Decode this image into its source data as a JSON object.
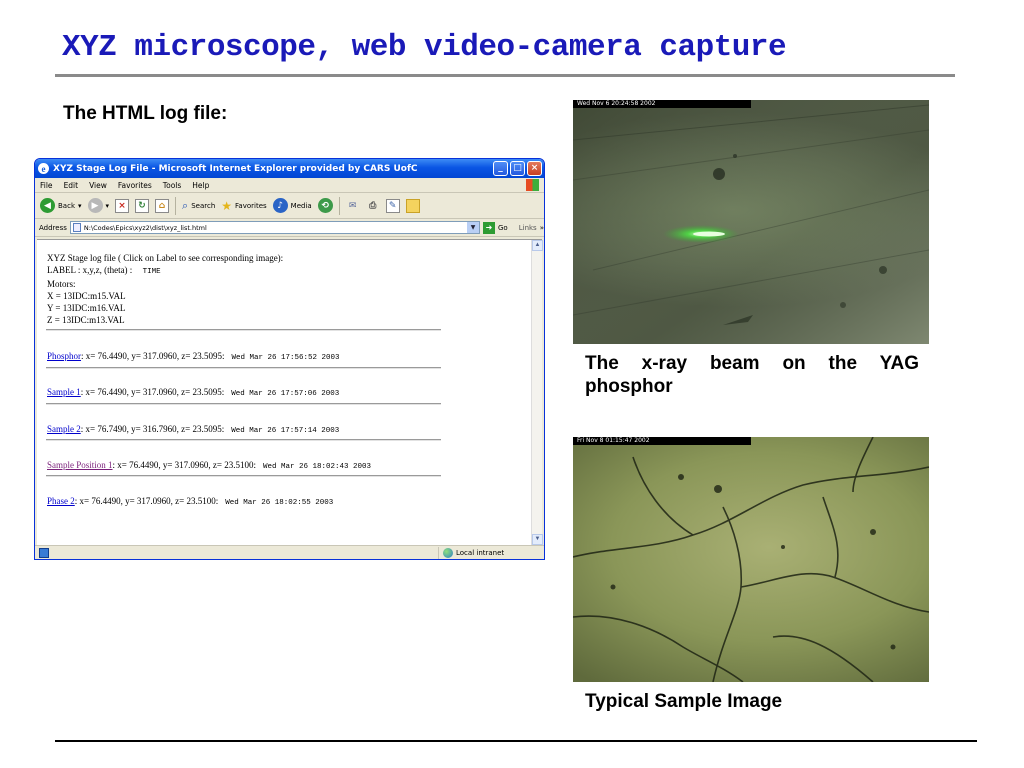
{
  "slide": {
    "title": "XYZ microscope, web video-camera capture",
    "section_label": "The HTML log file:"
  },
  "browser": {
    "window_title": "XYZ Stage Log File - Microsoft Internet Explorer provided by CARS UofC",
    "menu": [
      "File",
      "Edit",
      "View",
      "Favorites",
      "Tools",
      "Help"
    ],
    "toolbar": {
      "back": "Back",
      "search": "Search",
      "favorites": "Favorites",
      "media": "Media"
    },
    "address_label": "Address",
    "address": "N:\\Codes\\Epics\\xyz2\\dist\\xyz_list.html",
    "go": "Go",
    "links": "Links",
    "status_zone": "Local intranet"
  },
  "log": {
    "header_line": "XYZ Stage log file ( Click on Label to see corresponding image):",
    "label_line": "LABEL : x,y,z, (theta) :",
    "label_time": "TIME",
    "motors_heading": "Motors:",
    "motors": [
      "X = 13IDC:m15.VAL",
      "Y = 13IDC:m16.VAL",
      "Z = 13IDC:m13.VAL"
    ],
    "entries": [
      {
        "label": "Phosphor",
        "values": ": x= 76.4490, y= 317.0960, z= 23.5095:",
        "time": "Wed Mar 26 17:56:52 2003"
      },
      {
        "label": "Sample 1",
        "values": ": x= 76.4490, y= 317.0960, z= 23.5095:",
        "time": "Wed Mar 26 17:57:06 2003"
      },
      {
        "label": "Sample 2",
        "values": ": x= 76.7490, y= 316.7960, z= 23.5095:",
        "time": "Wed Mar 26 17:57:14 2003"
      },
      {
        "label": "Sample Position 1",
        "values": ": x= 76.4490, y= 317.0960, z= 23.5100:",
        "time": "Wed Mar 26 18:02:43 2003"
      },
      {
        "label": "Phase 2",
        "values": ": x= 76.4490, y= 317.0960, z= 23.5100:",
        "time": "Wed Mar 26 18:02:55 2003"
      }
    ]
  },
  "images": [
    {
      "timestamp": "Wed Nov  6 20:24:58 2002",
      "caption": "The x-ray beam on the  YAG phosphor"
    },
    {
      "timestamp": "Fri Nov  8 01:15:47 2002",
      "caption": "Typical Sample Image"
    }
  ]
}
